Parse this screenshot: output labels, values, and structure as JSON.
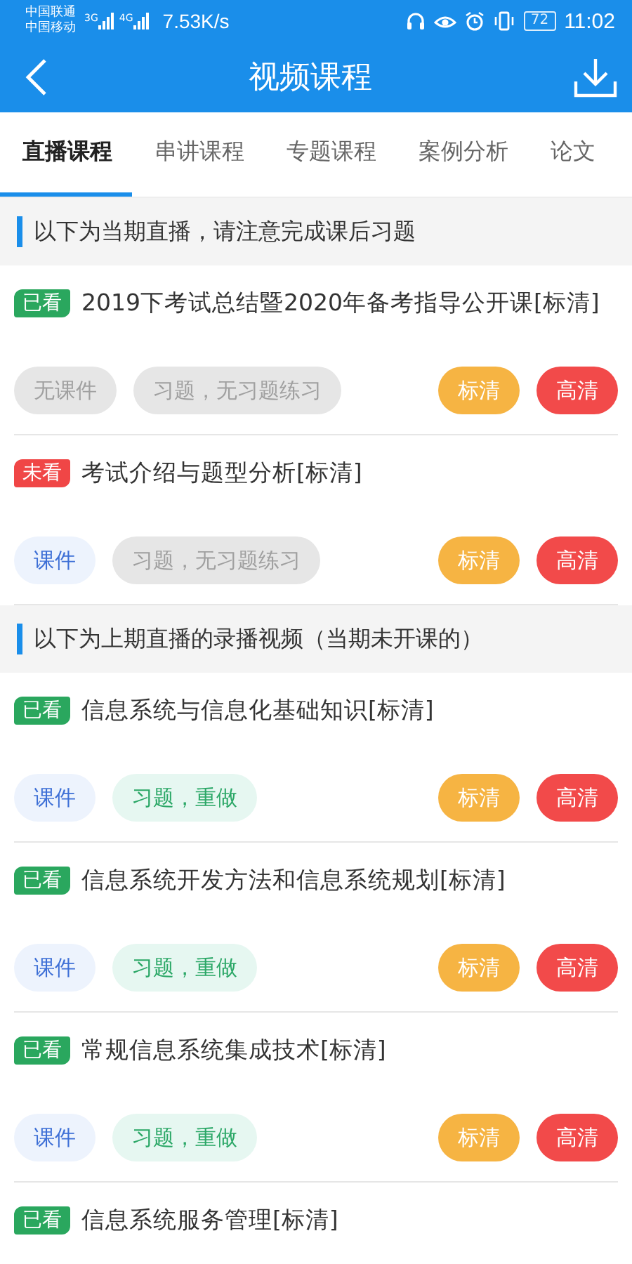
{
  "status_bar": {
    "carriers": [
      "中国联通",
      "中国移动"
    ],
    "networks": [
      "3G",
      "4G"
    ],
    "speed": "7.53K/s",
    "battery": "72",
    "time": "11:02"
  },
  "header": {
    "title": "视频课程"
  },
  "tabs": [
    {
      "label": "直播课程",
      "selected": true
    },
    {
      "label": "串讲课程",
      "selected": false
    },
    {
      "label": "专题课程",
      "selected": false
    },
    {
      "label": "案例分析",
      "selected": false
    },
    {
      "label": "论文",
      "selected": false
    }
  ],
  "sections": [
    {
      "notice": "以下为当期直播，请注意完成课后习题",
      "lessons": [
        {
          "badge": "已看",
          "watched": true,
          "title": "2019下考试总结暨2020年备考指导公开课[标清]",
          "buttons": [
            {
              "label": "无课件",
              "kind": "none"
            },
            {
              "label": "习题，无习题练习",
              "kind": "none"
            },
            {
              "label": "标清",
              "kind": "sd"
            },
            {
              "label": "高清",
              "kind": "hd"
            }
          ]
        },
        {
          "badge": "未看",
          "watched": false,
          "title": "考试介绍与题型分析[标清]",
          "buttons": [
            {
              "label": "课件",
              "kind": "courseware"
            },
            {
              "label": "习题，无习题练习",
              "kind": "none"
            },
            {
              "label": "标清",
              "kind": "sd"
            },
            {
              "label": "高清",
              "kind": "hd"
            }
          ]
        }
      ]
    },
    {
      "notice": "以下为上期直播的录播视频（当期未开课的）",
      "lessons": [
        {
          "badge": "已看",
          "watched": true,
          "title": "信息系统与信息化基础知识[标清]",
          "buttons": [
            {
              "label": "课件",
              "kind": "courseware"
            },
            {
              "label": "习题，重做",
              "kind": "redo"
            },
            {
              "label": "标清",
              "kind": "sd"
            },
            {
              "label": "高清",
              "kind": "hd"
            }
          ]
        },
        {
          "badge": "已看",
          "watched": true,
          "title": "信息系统开发方法和信息系统规划[标清]",
          "buttons": [
            {
              "label": "课件",
              "kind": "courseware"
            },
            {
              "label": "习题，重做",
              "kind": "redo"
            },
            {
              "label": "标清",
              "kind": "sd"
            },
            {
              "label": "高清",
              "kind": "hd"
            }
          ]
        },
        {
          "badge": "已看",
          "watched": true,
          "title": "常规信息系统集成技术[标清]",
          "buttons": [
            {
              "label": "课件",
              "kind": "courseware"
            },
            {
              "label": "习题，重做",
              "kind": "redo"
            },
            {
              "label": "标清",
              "kind": "sd"
            },
            {
              "label": "高清",
              "kind": "hd"
            }
          ]
        },
        {
          "badge": "已看",
          "watched": true,
          "title": "信息系统服务管理[标清]"
        }
      ]
    }
  ]
}
